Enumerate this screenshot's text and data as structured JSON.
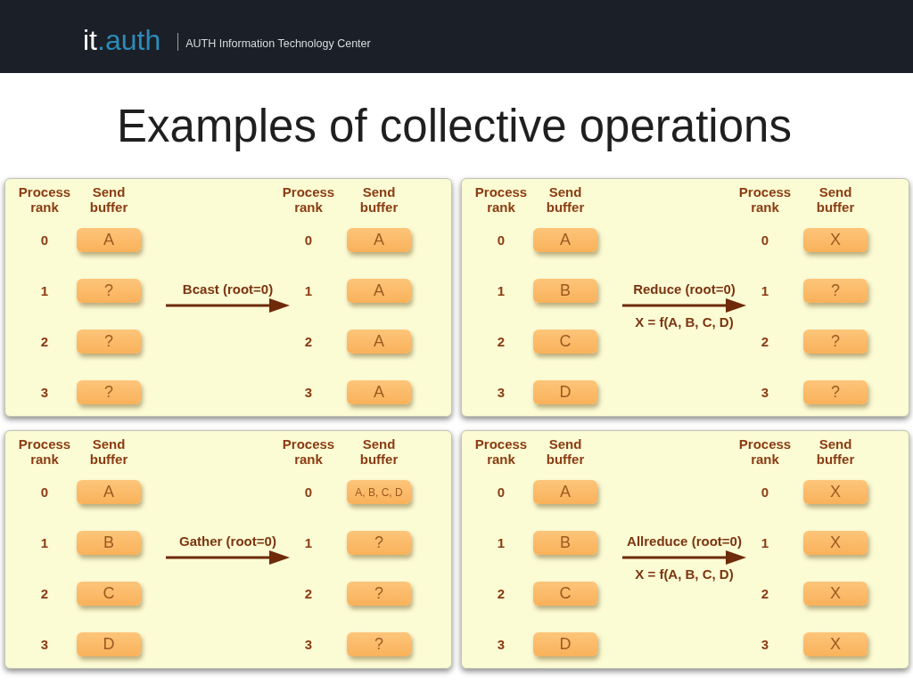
{
  "header": {
    "logo": {
      "prefix": "it",
      "suffix": ".auth"
    },
    "tagline": "AUTH Information Technology Center"
  },
  "title": "Examples of collective operations",
  "panels": [
    {
      "columns": [
        "Process rank",
        "Send buffer",
        "Process rank",
        "Send buffer"
      ],
      "operation": "Bcast (root=0)",
      "rows": [
        {
          "rank_before": "0",
          "buffer_before": "A",
          "rank_after": "0",
          "buffer_after": "A"
        },
        {
          "rank_before": "1",
          "buffer_before": "?",
          "rank_after": "1",
          "buffer_after": "A"
        },
        {
          "rank_before": "2",
          "buffer_before": "?",
          "rank_after": "2",
          "buffer_after": "A"
        },
        {
          "rank_before": "3",
          "buffer_before": "?",
          "rank_after": "3",
          "buffer_after": "A"
        }
      ]
    },
    {
      "columns": [
        "Process rank",
        "Send buffer",
        "Process rank",
        "Send buffer"
      ],
      "operation": "Reduce (root=0)",
      "formula": "X = f(A, B, C, D)",
      "rows": [
        {
          "rank_before": "0",
          "buffer_before": "A",
          "rank_after": "0",
          "buffer_after": "X"
        },
        {
          "rank_before": "1",
          "buffer_before": "B",
          "rank_after": "1",
          "buffer_after": "?"
        },
        {
          "rank_before": "2",
          "buffer_before": "C",
          "rank_after": "2",
          "buffer_after": "?"
        },
        {
          "rank_before": "3",
          "buffer_before": "D",
          "rank_after": "3",
          "buffer_after": "?"
        }
      ]
    },
    {
      "columns": [
        "Process rank",
        "Send buffer",
        "Process rank",
        "Send buffer"
      ],
      "operation": "Gather (root=0)",
      "rows": [
        {
          "rank_before": "0",
          "buffer_before": "A",
          "rank_after": "0",
          "buffer_after": "A, B, C, D"
        },
        {
          "rank_before": "1",
          "buffer_before": "B",
          "rank_after": "1",
          "buffer_after": "?"
        },
        {
          "rank_before": "2",
          "buffer_before": "C",
          "rank_after": "2",
          "buffer_after": "?"
        },
        {
          "rank_before": "3",
          "buffer_before": "D",
          "rank_after": "3",
          "buffer_after": "?"
        }
      ]
    },
    {
      "columns": [
        "Process rank",
        "Send buffer",
        "Process rank",
        "Send buffer"
      ],
      "operation": "Allreduce (root=0)",
      "formula": "X = f(A, B, C, D)",
      "rows": [
        {
          "rank_before": "0",
          "buffer_before": "A",
          "rank_after": "0",
          "buffer_after": "X"
        },
        {
          "rank_before": "1",
          "buffer_before": "B",
          "rank_after": "1",
          "buffer_after": "X"
        },
        {
          "rank_before": "2",
          "buffer_before": "C",
          "rank_after": "2",
          "buffer_after": "X"
        },
        {
          "rank_before": "3",
          "buffer_before": "D",
          "rank_after": "3",
          "buffer_after": "X"
        }
      ]
    }
  ]
}
